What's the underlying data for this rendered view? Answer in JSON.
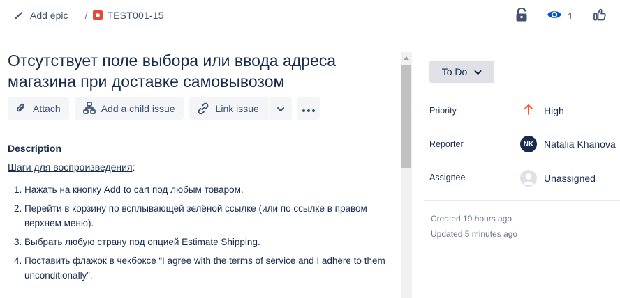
{
  "breadcrumb": {
    "add_epic": "Add epic",
    "separator": "/",
    "issue_key": "TEST001-15"
  },
  "header": {
    "watch_count": "1"
  },
  "issue": {
    "title": "Отсутствует поле выбора или ввода адреса магазина при доставке самовывозом"
  },
  "toolbar": {
    "attach": "Attach",
    "add_child": "Add a child issue",
    "link_issue": "Link issue"
  },
  "description": {
    "heading": "Description",
    "steps_heading": "Шаги для воспроизведения",
    "steps_colon": ":",
    "steps": [
      "Нажать на кнопку Add to cart под любым товаром.",
      "Перейти в корзину по всплывающей зелёной ссылке (или по ссылке в правом верхнем меню).",
      "Выбрать любую страну под опцией Estimate Shipping.",
      "Поставить флажок в чекбоксе “I agree with the terms of service and I adhere to them unconditionally”."
    ]
  },
  "sidebar": {
    "status": "To Do",
    "priority_label": "Priority",
    "priority_value": "High",
    "reporter_label": "Reporter",
    "reporter_initials": "NK",
    "reporter_name": "Natalia Khanova",
    "assignee_label": "Assignee",
    "assignee_value": "Unassigned",
    "created": "Created 19 hours ago",
    "updated": "Updated 5 minutes ago"
  },
  "colors": {
    "text": "#172b4d",
    "subtle": "#42526e",
    "priority_high": "#ff5630",
    "watch": "#0052cc",
    "issue_type_bug": "#e5493a"
  }
}
